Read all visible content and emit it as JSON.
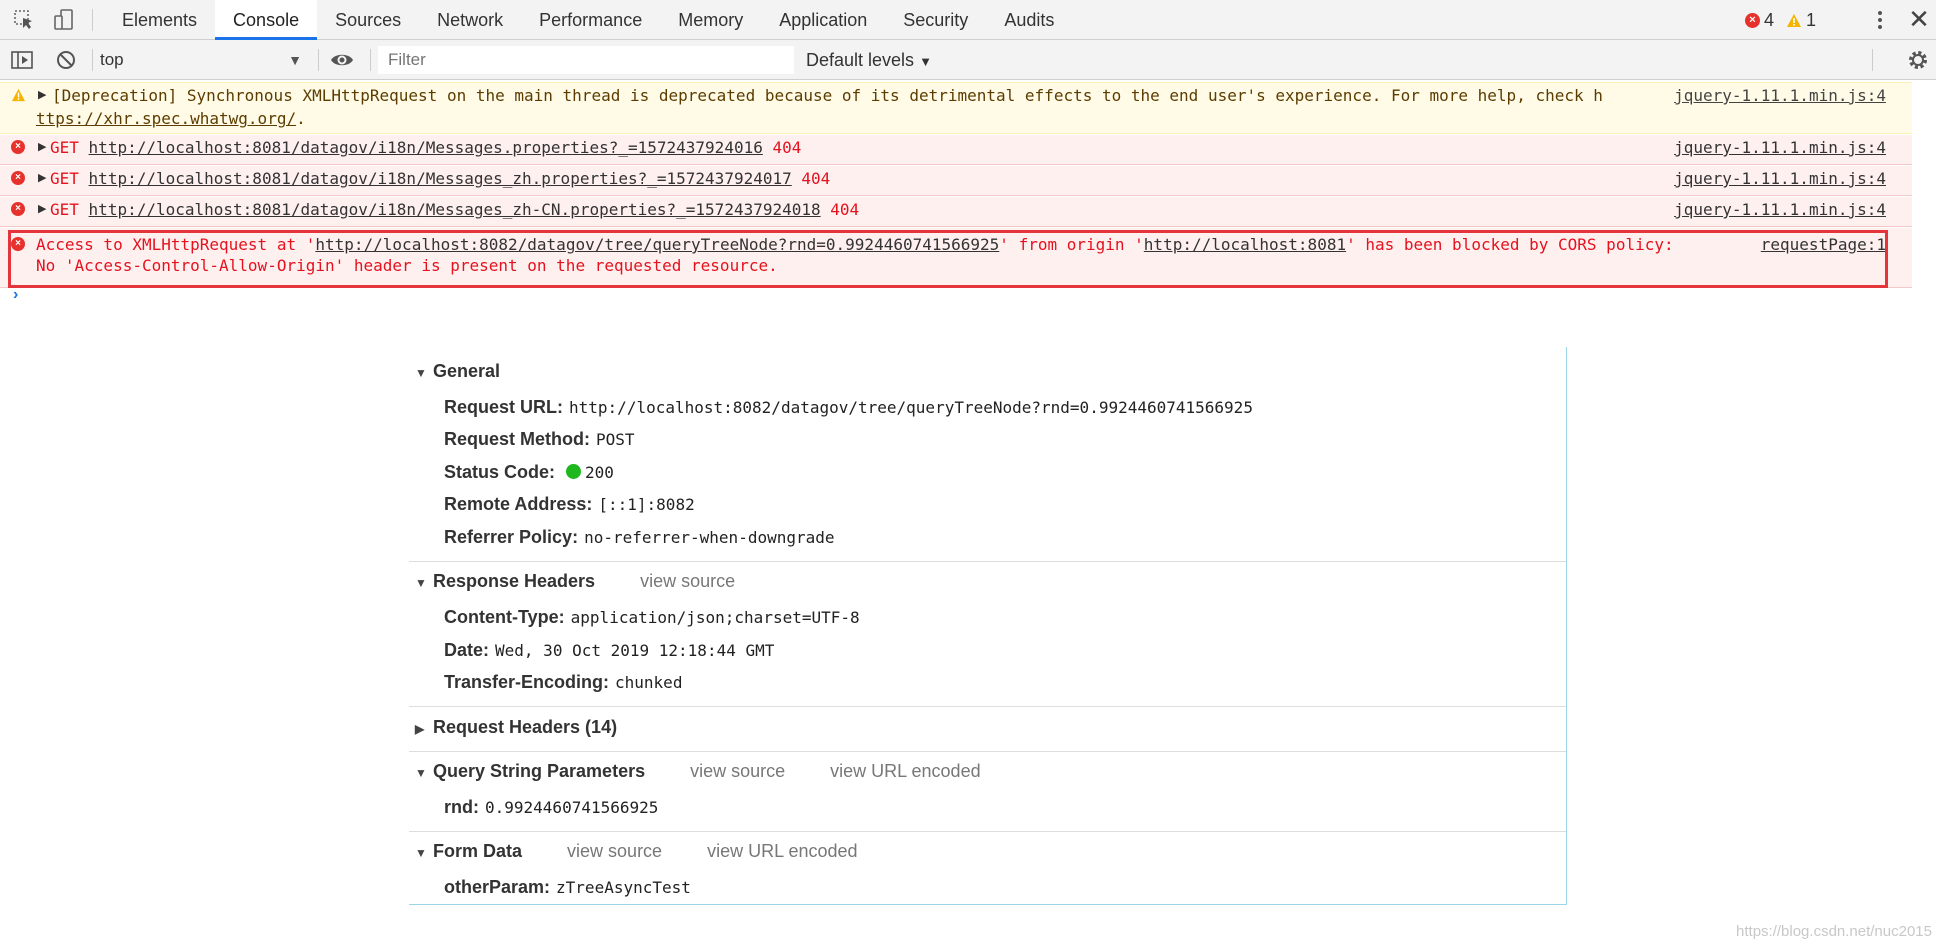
{
  "devtools": {
    "tabs": [
      {
        "label": "Elements"
      },
      {
        "label": "Console"
      },
      {
        "label": "Sources"
      },
      {
        "label": "Network"
      },
      {
        "label": "Performance"
      },
      {
        "label": "Memory"
      },
      {
        "label": "Application"
      },
      {
        "label": "Security"
      },
      {
        "label": "Audits"
      }
    ],
    "active_tab": "Console",
    "error_count": "4",
    "warning_count": "1"
  },
  "toolbar": {
    "context": "top",
    "filter_placeholder": "Filter",
    "levels": "Default levels"
  },
  "messages": [
    {
      "level": "warning",
      "text": "[Deprecation] Synchronous XMLHttpRequest on the main thread is deprecated because of its detrimental effects to the end user's experience. For more help, check h",
      "text2": "ttps://xhr.spec.whatwg.org/",
      "text2_suffix": ".",
      "source": "jquery-1.11.1.min.js:4"
    },
    {
      "level": "error",
      "method": "GET",
      "url": "http://localhost:8081/datagov/i18n/Messages.properties?_=1572437924016",
      "status": "404",
      "source": "jquery-1.11.1.min.js:4"
    },
    {
      "level": "error",
      "method": "GET",
      "url": "http://localhost:8081/datagov/i18n/Messages_zh.properties?_=1572437924017",
      "status": "404",
      "source": "jquery-1.11.1.min.js:4"
    },
    {
      "level": "error",
      "method": "GET",
      "url": "http://localhost:8081/datagov/i18n/Messages_zh-CN.properties?_=1572437924018",
      "status": "404",
      "source": "jquery-1.11.1.min.js:4"
    },
    {
      "level": "error",
      "prefix": "Access to XMLHttpRequest at '",
      "url": "http://localhost:8082/datagov/tree/queryTreeNode?rnd=0.9924460741566925",
      "middle": "' from origin '",
      "origin": "http://localhost:8081",
      "suffix": "' has been blocked by CORS policy:",
      "line2": "No 'Access-Control-Allow-Origin' header is present on the requested resource.",
      "source": "requestPage:1"
    }
  ],
  "headers_panel": {
    "general": {
      "title": "General",
      "rows": [
        {
          "key": "Request URL:",
          "value": "http://localhost:8082/datagov/tree/queryTreeNode?rnd=0.9924460741566925"
        },
        {
          "key": "Request Method:",
          "value": "POST"
        },
        {
          "key": "Status Code:",
          "value": "200"
        },
        {
          "key": "Remote Address:",
          "value": "[::1]:8082"
        },
        {
          "key": "Referrer Policy:",
          "value": "no-referrer-when-downgrade"
        }
      ]
    },
    "response_headers": {
      "title": "Response Headers",
      "view_source": "view source",
      "rows": [
        {
          "key": "Content-Type:",
          "value": "application/json;charset=UTF-8"
        },
        {
          "key": "Date:",
          "value": "Wed, 30 Oct 2019 12:18:44 GMT"
        },
        {
          "key": "Transfer-Encoding:",
          "value": "chunked"
        }
      ]
    },
    "request_headers": {
      "title": "Request Headers (14)"
    },
    "query_string": {
      "title": "Query String Parameters",
      "view_source": "view source",
      "view_encoded": "view URL encoded",
      "rows": [
        {
          "key": "rnd:",
          "value": "0.9924460741566925"
        }
      ]
    },
    "form_data": {
      "title": "Form Data",
      "view_source": "view source",
      "view_encoded": "view URL encoded",
      "rows": [
        {
          "key": "otherParam:",
          "value": "zTreeAsyncTest"
        }
      ]
    }
  },
  "watermark": "https://blog.csdn.net/nuc2015",
  "colors": {
    "accent": "#1a73e8",
    "error": "#e4121e",
    "warning_bg": "#fffbe6",
    "error_bg": "#fff0f0",
    "highlight": "#e4343c"
  }
}
